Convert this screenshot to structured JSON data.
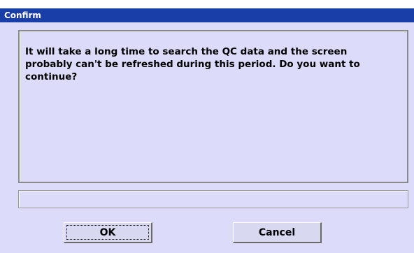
{
  "dialog": {
    "title": "Confirm",
    "message": "It will take a long time to search the  QC data and the screen probably can't be refreshed during this period. Do you want to continue?",
    "status_text": "",
    "buttons": {
      "ok_label": "OK",
      "cancel_label": "Cancel"
    }
  },
  "colors": {
    "titlebar": "#1a3ea8",
    "dialog_background": "#dcdcfa"
  }
}
